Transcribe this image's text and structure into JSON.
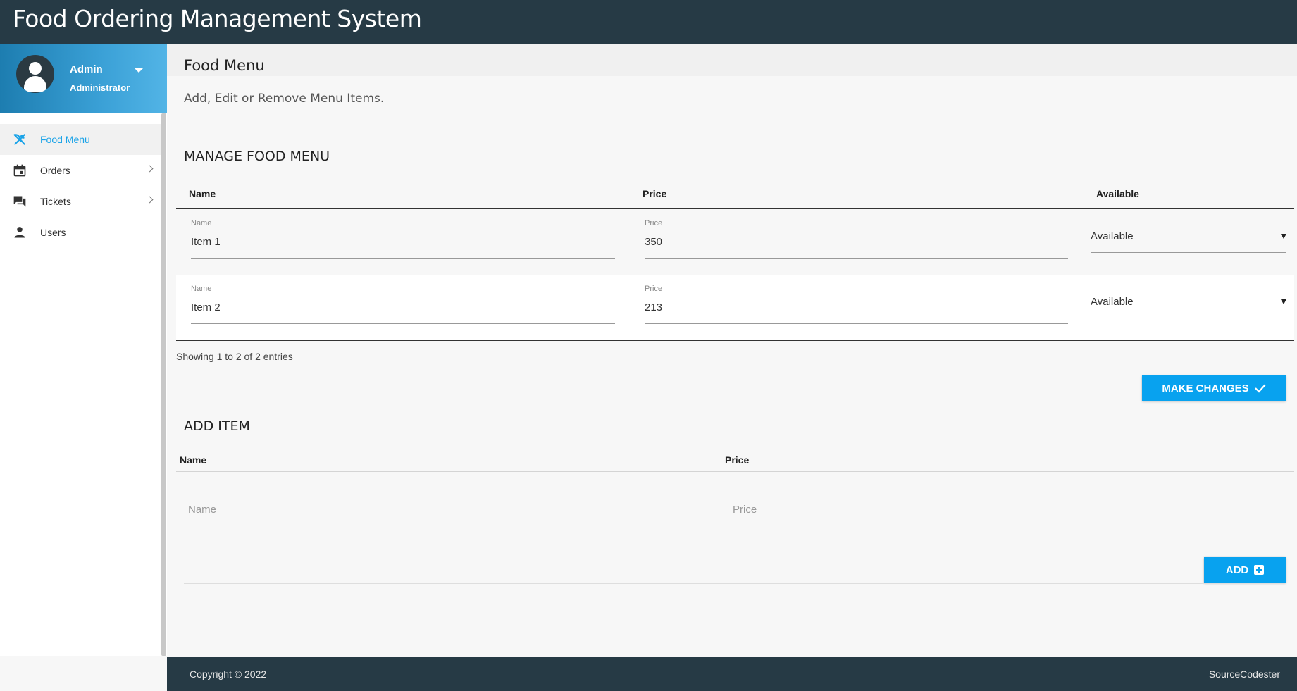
{
  "app": {
    "title": "Food Ordering Management System"
  },
  "user": {
    "name": "Admin",
    "role": "Administrator"
  },
  "sidebar": {
    "items": [
      {
        "label": "Food Menu",
        "icon": "utensils-icon",
        "active": true
      },
      {
        "label": "Orders",
        "icon": "calendar-icon",
        "has_submenu": true
      },
      {
        "label": "Tickets",
        "icon": "chat-icon",
        "has_submenu": true
      },
      {
        "label": "Users",
        "icon": "person-icon"
      }
    ]
  },
  "page": {
    "title": "Food Menu",
    "subtitle": "Add, Edit or Remove Menu Items."
  },
  "manage": {
    "title": "MANAGE FOOD MENU",
    "columns": [
      "Name",
      "Price",
      "Available"
    ],
    "rows": [
      {
        "name_label": "Name",
        "name": "Item 1",
        "price_label": "Price",
        "price": "350",
        "available": "Available"
      },
      {
        "name_label": "Name",
        "name": "Item 2",
        "price_label": "Price",
        "price": "213",
        "available": "Available"
      }
    ],
    "entries_text": "Showing 1 to 2 of 2 entries",
    "make_changes_label": "MAKE CHANGES"
  },
  "add_item": {
    "title": "ADD ITEM",
    "columns": [
      "Name",
      "Price"
    ],
    "name_placeholder": "Name",
    "price_placeholder": "Price",
    "add_label": "ADD"
  },
  "footer": {
    "copyright": "Copyright © 2022",
    "brand": "SourceCodester"
  },
  "colors": {
    "topbar": "#263a45",
    "accent": "#08a2ef",
    "active_nav": "#1aa3e8"
  }
}
